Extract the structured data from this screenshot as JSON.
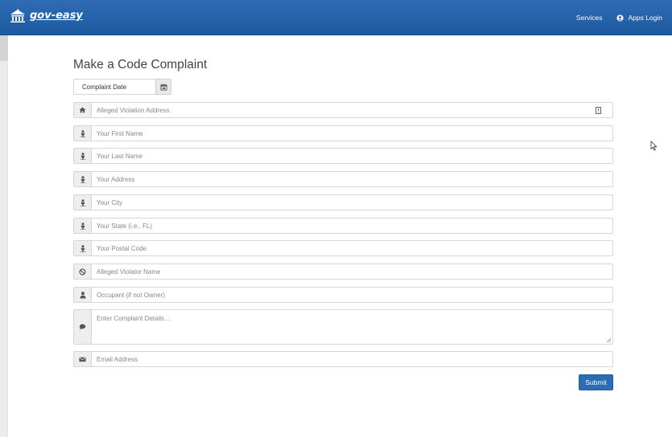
{
  "nav": {
    "brand": "gov-easy",
    "services": "Services",
    "apps_login": "Apps Login"
  },
  "form": {
    "title": "Make a Code Complaint",
    "complaint_date": "Complaint Date",
    "fields": [
      {
        "placeholder": "Alleged Violation Address",
        "icon": "home-icon"
      },
      {
        "placeholder": "Your First Name",
        "icon": "person-icon"
      },
      {
        "placeholder": "Your Last Name",
        "icon": "person-icon"
      },
      {
        "placeholder": "Your Address",
        "icon": "person-icon"
      },
      {
        "placeholder": "Your City",
        "icon": "person-icon"
      },
      {
        "placeholder": "Your State (i.e., FL)",
        "icon": "person-icon"
      },
      {
        "placeholder": "Your Postal Code",
        "icon": "person-icon"
      },
      {
        "placeholder": "Alleged Violator Name",
        "icon": "ban-icon"
      },
      {
        "placeholder": "Occupant (if not Owner)",
        "icon": "user-icon"
      },
      {
        "placeholder": "Enter Complaint Details...",
        "icon": "comment-icon"
      },
      {
        "placeholder": "Email Address",
        "icon": "envelope-icon"
      }
    ],
    "submit": "Submit"
  },
  "colors": {
    "navbar": "#1f5ea5",
    "submit": "#2a6db5"
  }
}
